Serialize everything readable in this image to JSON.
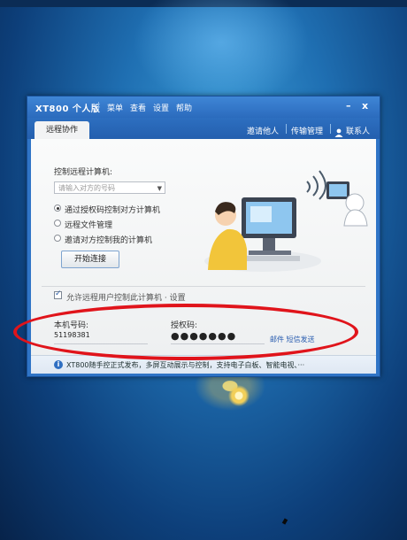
{
  "window": {
    "brand": "XT800 个人版",
    "menus": [
      "菜单",
      "查看",
      "设置",
      "帮助"
    ],
    "minimize": "–",
    "close": "x"
  },
  "tabs": {
    "active": "远程协作"
  },
  "top_links": {
    "invite": "邀请他人",
    "transfer": "传输管理",
    "contacts": "联系人"
  },
  "control": {
    "heading": "控制远程计算机:",
    "input_placeholder": "请输入对方的号码",
    "options": [
      "通过授权码控制对方计算机",
      "远程文件管理",
      "邀请对方控制我的计算机"
    ],
    "selected_option": 0,
    "start_button": "开始连接"
  },
  "allow": {
    "label": "允许远程用户控制此计算机 · 设置",
    "checked": true
  },
  "local": {
    "number_label": "本机号码:",
    "number_value": "51198381",
    "auth_label": "授权码:",
    "auth_value": "●●●●●●●",
    "link": "邮件 短信发送"
  },
  "status": {
    "message": "XT800随手控正式发布，多屏互动展示与控制，支持电子白板、智能电视、···"
  },
  "colors": {
    "accent": "#2f74c6",
    "highlight_ring": "#e0141b"
  }
}
